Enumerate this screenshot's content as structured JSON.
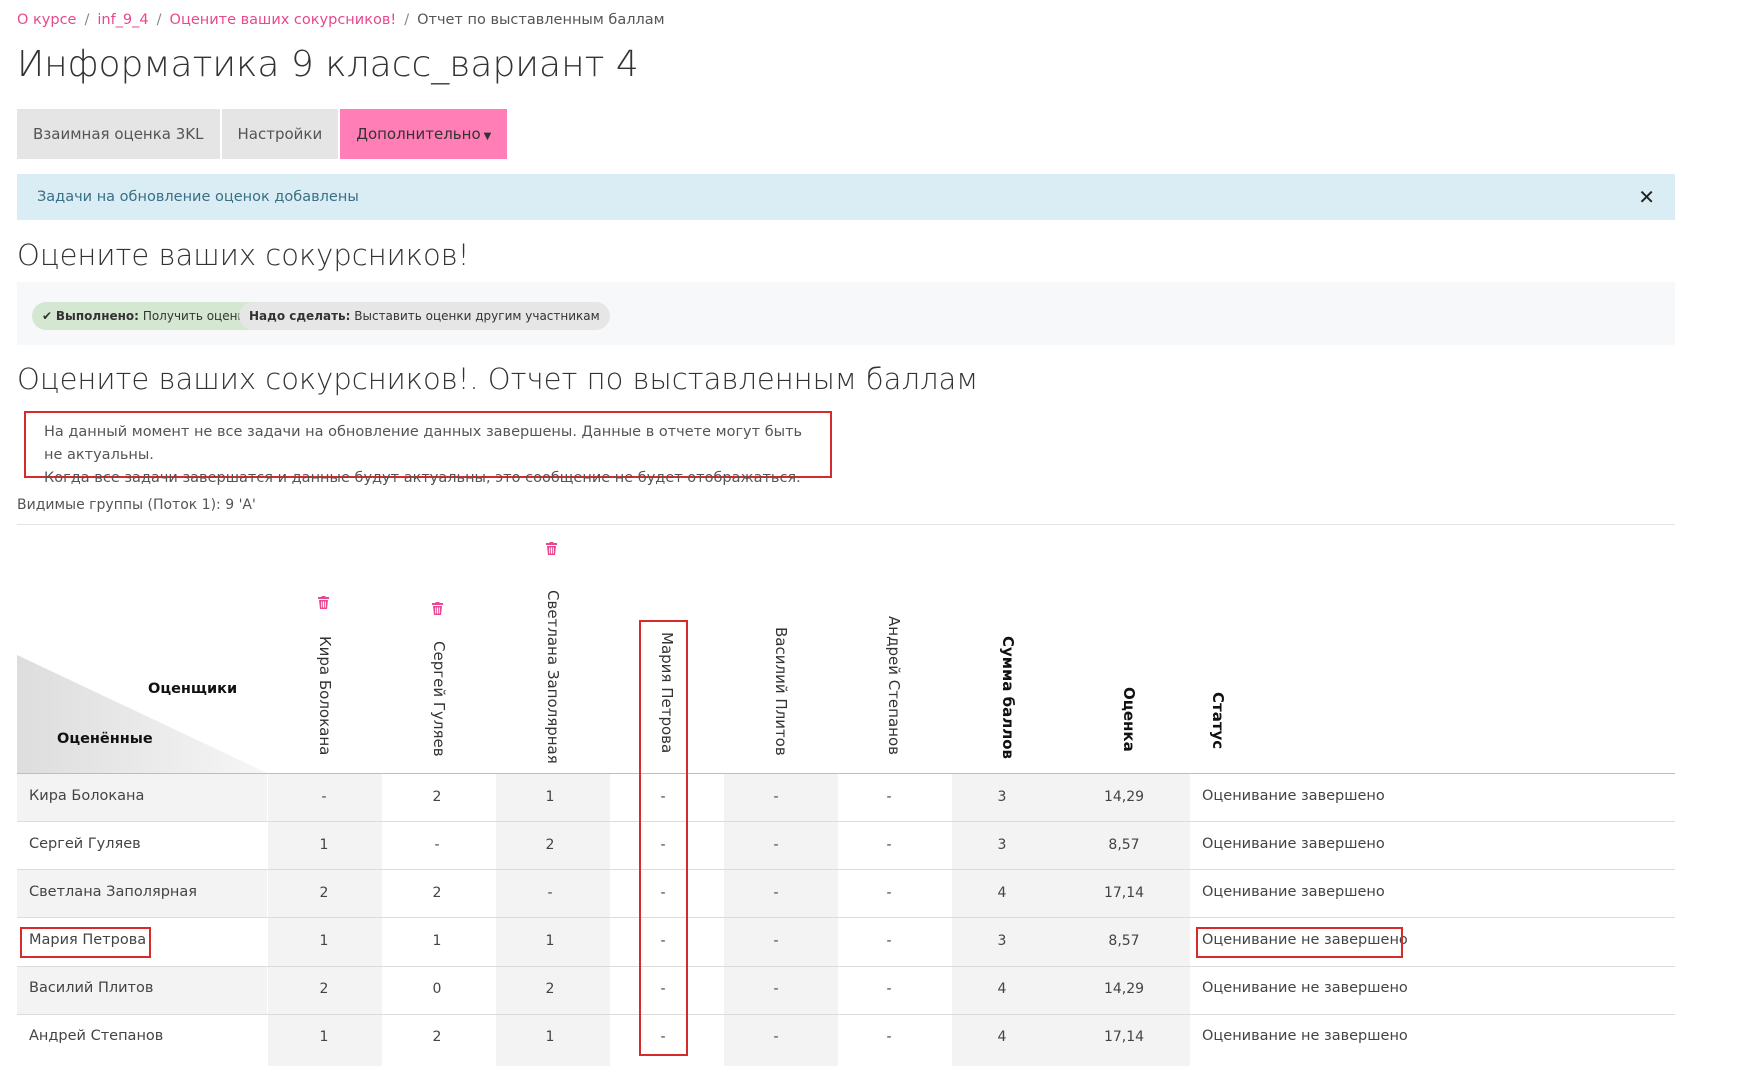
{
  "breadcrumb": {
    "items": [
      "О курсе",
      "inf_9_4",
      "Оцените ваших сокурсников!"
    ],
    "current": "Отчет по выставленным баллам"
  },
  "page_title": "Информатика 9 класс_вариант 4",
  "tabs": [
    {
      "label": "Взаимная оценка 3KL"
    },
    {
      "label": "Настройки"
    },
    {
      "label": "Дополнительно"
    }
  ],
  "alert": {
    "text": "Задачи на обновление оценок добавлены",
    "close": "✕"
  },
  "activity_title": "Оцените ваших сокурсников!",
  "completion": {
    "done_label": "Выполнено:",
    "done_text": "Получить оценку",
    "todo_label": "Надо сделать:",
    "todo_text": "Выставить оценки другим участникам"
  },
  "report_title": "Оцените ваших сокурсников!. Отчет по выставленным баллам",
  "warning": {
    "line1": "На данный момент не все задачи на обновление данных завершены. Данные в отчете могут быть не актуальны.",
    "line2": "Когда все задачи завершатся и данные будут актуальны, это сообщение не будет отображаться."
  },
  "groups_text": "Видимые группы (Поток 1): 9 'А'",
  "table": {
    "corner_top": "Оценщики",
    "corner_bottom": "Оценённые",
    "raters": [
      "Кира Болокана",
      "Сергей Гуляев",
      "Светлана Заполярная",
      "Мария Петрова",
      "Василий Плитов",
      "Андрей Степанов"
    ],
    "sum_header": "Сумма баллов",
    "grade_header": "Оценка",
    "status_header": "Статус",
    "rows": [
      {
        "name": "Кира Болокана",
        "scores": [
          "-",
          "2",
          "1",
          "-",
          "-",
          "-"
        ],
        "sum": "3",
        "grade": "14,29",
        "status": "Оценивание завершено"
      },
      {
        "name": "Сергей Гуляев",
        "scores": [
          "1",
          "-",
          "2",
          "-",
          "-",
          "-"
        ],
        "sum": "3",
        "grade": "8,57",
        "status": "Оценивание завершено"
      },
      {
        "name": "Светлана Заполярная",
        "scores": [
          "2",
          "2",
          "-",
          "-",
          "-",
          "-"
        ],
        "sum": "4",
        "grade": "17,14",
        "status": "Оценивание завершено"
      },
      {
        "name": "Мария Петрова",
        "scores": [
          "1",
          "1",
          "1",
          "-",
          "-",
          "-"
        ],
        "sum": "3",
        "grade": "8,57",
        "status": "Оценивание не завершено"
      },
      {
        "name": "Василий Плитов",
        "scores": [
          "2",
          "0",
          "2",
          "-",
          "-",
          "-"
        ],
        "sum": "4",
        "grade": "14,29",
        "status": "Оценивание не завершено"
      },
      {
        "name": "Андрей Степанов",
        "scores": [
          "1",
          "2",
          "1",
          "-",
          "-",
          "-"
        ],
        "sum": "4",
        "grade": "17,14",
        "status": "Оценивание не завершено"
      }
    ]
  },
  "colors": {
    "accent": "#e8488f",
    "active_tab": "#ff7eb6",
    "highlight_border": "#d62b2b",
    "info_bg": "#daedf4"
  },
  "icons": [
    "trash-icon",
    "check-icon",
    "chevron-down-icon",
    "close-icon"
  ]
}
